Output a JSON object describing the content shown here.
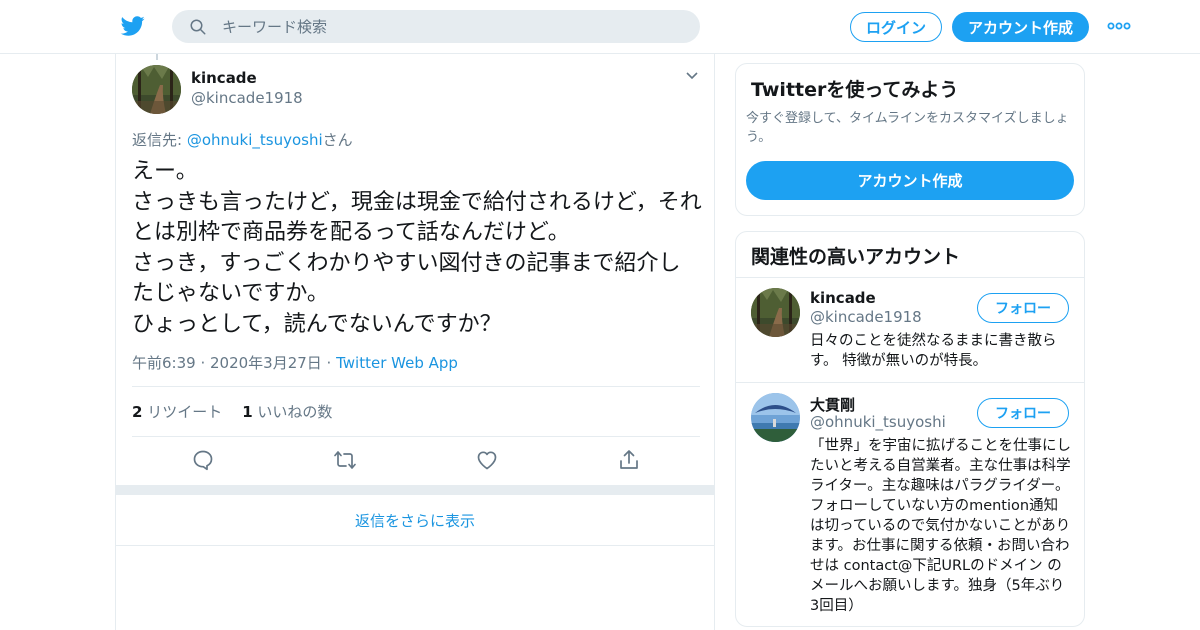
{
  "colors": {
    "accent": "#1da1f2",
    "link": "#1b95e0",
    "muted": "#657786",
    "border": "#e6ecf0"
  },
  "header": {
    "logo_icon": "twitter-bird-icon",
    "search_placeholder": "キーワード検索",
    "login_label": "ログイン",
    "signup_label": "アカウント作成",
    "more_icon": "more-dots-icon"
  },
  "tweet": {
    "author_name": "kincade",
    "author_handle": "@kincade1918",
    "reply_prefix": "返信先: ",
    "reply_handle": "@ohnuki_tsuyoshi",
    "reply_suffix": "さん",
    "text": "えー。\nさっきも言ったけど，現金は現金で給付されるけど，それとは別枠で商品券を配るって話なんだけど。\nさっき，すっごくわかりやすい図付きの記事まで紹介したじゃないですか。\nひょっとして，読んでないんですか？",
    "timestamp": "午前6:39 · 2020年3月27日 · ",
    "source": "Twitter Web App",
    "retweet_count": "2",
    "retweet_label": " リツイート",
    "like_count": "1",
    "like_label": " いいねの数",
    "actions": [
      "reply-icon",
      "retweet-icon",
      "like-icon",
      "share-icon"
    ]
  },
  "more_replies_label": "返信をさらに表示",
  "signup_card": {
    "title": "Twitterを使ってみよう",
    "description": "今すぐ登録して、タイムラインをカスタマイズしましょう。",
    "button_label": "アカウント作成"
  },
  "related": {
    "title": "関連性の高いアカウント",
    "accounts": [
      {
        "name": "kincade",
        "handle": "@kincade1918",
        "follow_label": "フォロー",
        "bio": "日々のことを徒然なるままに書き散らす。 特徴が無いのが特長。"
      },
      {
        "name": "大貫剛",
        "handle": "@ohnuki_tsuyoshi",
        "follow_label": "フォロー",
        "bio": "「世界」を宇宙に拡げることを仕事にしたいと考える自営業者。主な仕事は科学ライター。主な趣味はパラグライダー。フォローしていない方のmention通知は切っているので気付かないことがあります。お仕事に関する依頼・お問い合わせは contact@下記URLのドメイン のメールへお願いします。独身（5年ぶり3回目）"
      }
    ]
  }
}
